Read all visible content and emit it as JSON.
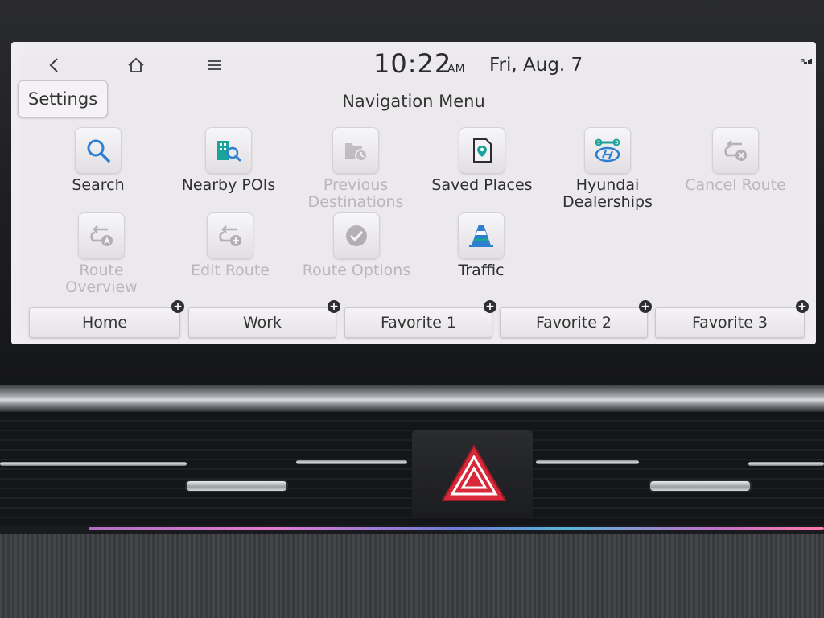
{
  "status_bar": {
    "back_icon": "chevron-left-icon",
    "home_icon": "home-icon",
    "menu_icon": "hamburger-icon",
    "time": "10:22",
    "ampm": "AM",
    "date": "Fri, Aug. 7",
    "signal_label": "B",
    "signal_icon": "bluetooth-signal-icon"
  },
  "header": {
    "settings_label": "Settings",
    "title": "Navigation Menu"
  },
  "menu": {
    "items": [
      {
        "label": "Search",
        "icon": "search-icon",
        "enabled": true
      },
      {
        "label": "Nearby POIs",
        "icon": "nearby-pois-icon",
        "enabled": true
      },
      {
        "label": "Previous Destinations",
        "label_lines": [
          "Previous",
          "Destinations"
        ],
        "icon": "previous-destinations-icon",
        "enabled": false
      },
      {
        "label": "Saved Places",
        "icon": "saved-places-icon",
        "enabled": true
      },
      {
        "label": "Hyundai Dealerships",
        "label_lines": [
          "Hyundai",
          "Dealerships"
        ],
        "icon": "hyundai-dealer-icon",
        "enabled": true
      },
      {
        "label": "Cancel Route",
        "icon": "cancel-route-icon",
        "enabled": false
      },
      {
        "label": "Route Overview",
        "label_lines": [
          "Route",
          "Overview"
        ],
        "icon": "route-overview-icon",
        "enabled": false
      },
      {
        "label": "Edit Route",
        "icon": "edit-route-icon",
        "enabled": false
      },
      {
        "label": "Route Options",
        "icon": "route-options-icon",
        "enabled": false
      },
      {
        "label": "Traffic",
        "icon": "traffic-cone-icon",
        "enabled": true
      }
    ]
  },
  "favorites": [
    {
      "label": "Home"
    },
    {
      "label": "Work"
    },
    {
      "label": "Favorite 1"
    },
    {
      "label": "Favorite 2"
    },
    {
      "label": "Favorite 3"
    }
  ],
  "colors": {
    "screen_bg": "#ece9ed",
    "accent_teal": "#1aa39a",
    "accent_blue": "#2f7fd0",
    "hazard_red": "#d8283a"
  }
}
